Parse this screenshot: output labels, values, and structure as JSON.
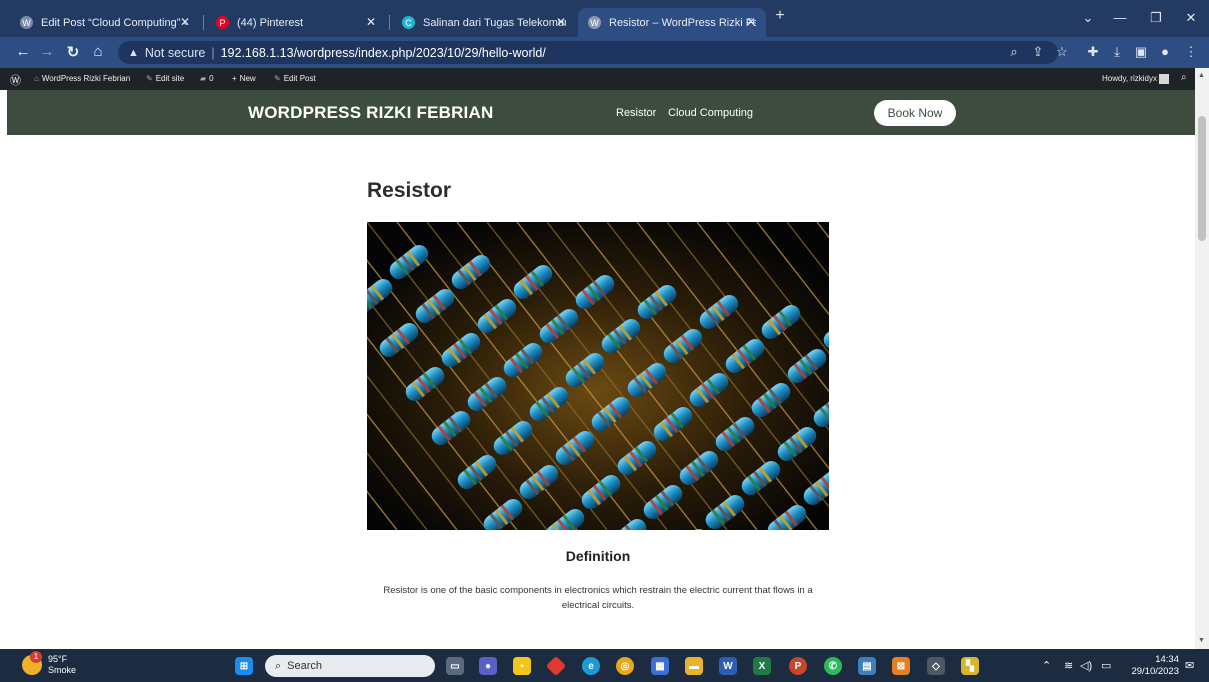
{
  "browser": {
    "tabs": [
      {
        "label": "Edit Post “Cloud Computing” ‹ W",
        "icon": "wordpress-tab-icon",
        "active": false
      },
      {
        "label": "(44) Pinterest",
        "icon": "pinterest-tab-icon",
        "active": false
      },
      {
        "label": "Salinan dari Tugas Telekomunika",
        "icon": "canva-tab-icon",
        "active": false
      },
      {
        "label": "Resistor – WordPress Rizki Febri",
        "icon": "wordpress-tab-icon",
        "active": true
      }
    ],
    "new_tab_label": "+",
    "address": {
      "security": "Not secure",
      "url": "192.168.1.13/wordpress/index.php/2023/10/29/hello-world/"
    }
  },
  "adminbar": {
    "site_name": "WordPress Rizki Febrian",
    "edit_site": "Edit site",
    "comments": "0",
    "new": "New",
    "edit_post": "Edit Post",
    "howdy": "Howdy, rizkidyx"
  },
  "site": {
    "title": "WORDPRESS RIZKI FEBRIAN",
    "nav": [
      "Resistor",
      "Cloud Computing"
    ],
    "cta": "Book Now"
  },
  "post": {
    "title": "Resistor",
    "image_alt": "Resistors",
    "section_heading": "Definition",
    "body": "Resistor is one of the basic components in electronics which restrain the electric current that flows in a electrical circuits."
  },
  "taskbar": {
    "weather_temp": "95°F",
    "weather_desc": "Smoke",
    "weather_badge": "1",
    "search_placeholder": "Search",
    "time": "14:34",
    "date": "29/10/2023"
  },
  "colors": {
    "site_header": "#3e4c3f",
    "tab_strip": "#233a63",
    "admin_bar": "#1d2327"
  }
}
